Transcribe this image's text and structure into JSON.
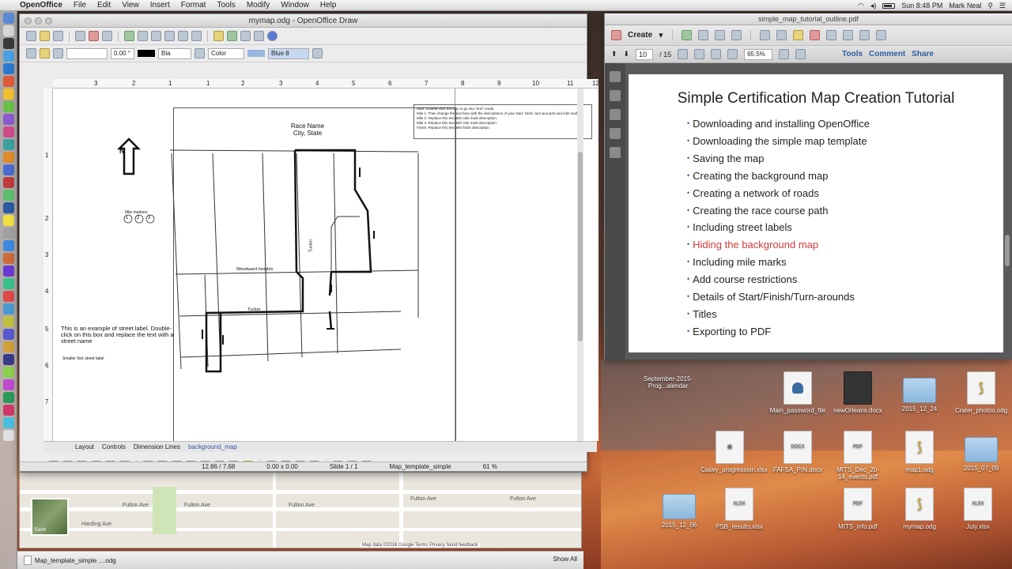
{
  "menubar": {
    "app": "OpenOffice",
    "items": [
      "File",
      "Edit",
      "View",
      "Insert",
      "Format",
      "Tools",
      "Modify",
      "Window",
      "Help"
    ],
    "clock": "Sun 8:48 PM",
    "user": "Mark Neal"
  },
  "oo_window": {
    "title": "mymap.odg - OpenOffice Draw",
    "angle": "0.00 °",
    "line_color": "Bla",
    "area_type": "Color",
    "area_color": "Blue 8",
    "ruler_h": [
      "3",
      "2",
      "1",
      "1",
      "2",
      "3",
      "4",
      "5",
      "6",
      "7",
      "8",
      "9",
      "10",
      "11",
      "12"
    ],
    "ruler_v": [
      "1",
      "2",
      "3",
      "4",
      "5",
      "6",
      "7"
    ],
    "layers": [
      "Layout",
      "Controls",
      "Dimension Lines",
      "background_map"
    ],
    "status": {
      "position": "12.86 / 7.68",
      "size": "0.00 x 0.00",
      "slide": "Slide 1 / 1",
      "master": "Map_template_simple",
      "zoom": "61 %"
    }
  },
  "map_doc": {
    "race_name": "Race Name",
    "city_state": "City, State",
    "north": "N",
    "mile_markers_label": "Mile markers",
    "mile_markers": [
      "1",
      "2",
      "3"
    ],
    "street_label_example": "This is an example of street label. Double-click on this box and replace the text with a street name",
    "smaller_label": "Smaller font street label",
    "streets": [
      "Woodward Heights",
      "Tucker",
      "Tucker"
    ],
    "info_lines": [
      "Start: Double-click this box to go into \"text\" mode.",
      "Mile 1: Then change the text here with the descriptions of your start, finish, turn-arounds and mile marks.",
      "Mile 2: Replace this text with mile mark description.",
      "Mile 3: Replace this text with mile mark description.",
      "Finish: Replace this text with finish description."
    ]
  },
  "pdf_window": {
    "title": "simple_map_tutorial_outline.pdf",
    "create_label": "Create",
    "page_current": "10",
    "page_total": "/ 15",
    "zoom": "65.5%",
    "links": [
      "Tools",
      "Comment",
      "Share"
    ],
    "heading": "Simple Certification Map Creation Tutorial",
    "outline": [
      "Downloading and installing OpenOffice",
      "Downloading the simple map template",
      "Saving the map",
      "Creating the background map",
      "Creating a network of roads",
      "Creating the race course path",
      "Including street labels",
      "Hiding the background map",
      "Including mile marks",
      "Add course restrictions",
      "Details of Start/Finish/Turn-arounds",
      "Titles",
      "Exporting to PDF"
    ],
    "highlight_color": "#d23a3a"
  },
  "desktop_icons": [
    {
      "label": "September-2015-Prog...alendar",
      "kind": "doc"
    },
    {
      "label": "Main_password_file",
      "kind": "doc"
    },
    {
      "label": "newOrleans.docx",
      "kind": "doc"
    },
    {
      "label": "2015_12_24",
      "kind": "folder"
    },
    {
      "label": "Crater_photos.odg",
      "kind": "doc"
    },
    {
      "label": "Casey_progression.xlsx",
      "kind": "doc"
    },
    {
      "label": "FAFSA_PIN.docx",
      "kind": "doc"
    },
    {
      "label": "MITS_Dec_20-14_events.pdf",
      "kind": "doc"
    },
    {
      "label": "map1.odg",
      "kind": "doc"
    },
    {
      "label": "2015_07_09",
      "kind": "folder"
    },
    {
      "label": "2015_12_06",
      "kind": "folder"
    },
    {
      "label": "PSB_results.xlsx",
      "kind": "doc"
    },
    {
      "label": "MITS_info.pdf",
      "kind": "doc"
    },
    {
      "label": "mymap.odg",
      "kind": "doc"
    },
    {
      "label": "July.xlsx",
      "kind": "doc"
    }
  ],
  "map_window": {
    "streets": [
      "Fulton Ave",
      "Fulton Ave",
      "Fulton Ave",
      "Fulton Ave",
      "Fulton Ave",
      "Harding Ave"
    ],
    "earth": "Earth",
    "footer": "Map data ©2016 Google   Terms   Privacy   Send feedback"
  },
  "taskbar": {
    "file": "Map_template_simple ....odg",
    "show_all": "Show All"
  }
}
